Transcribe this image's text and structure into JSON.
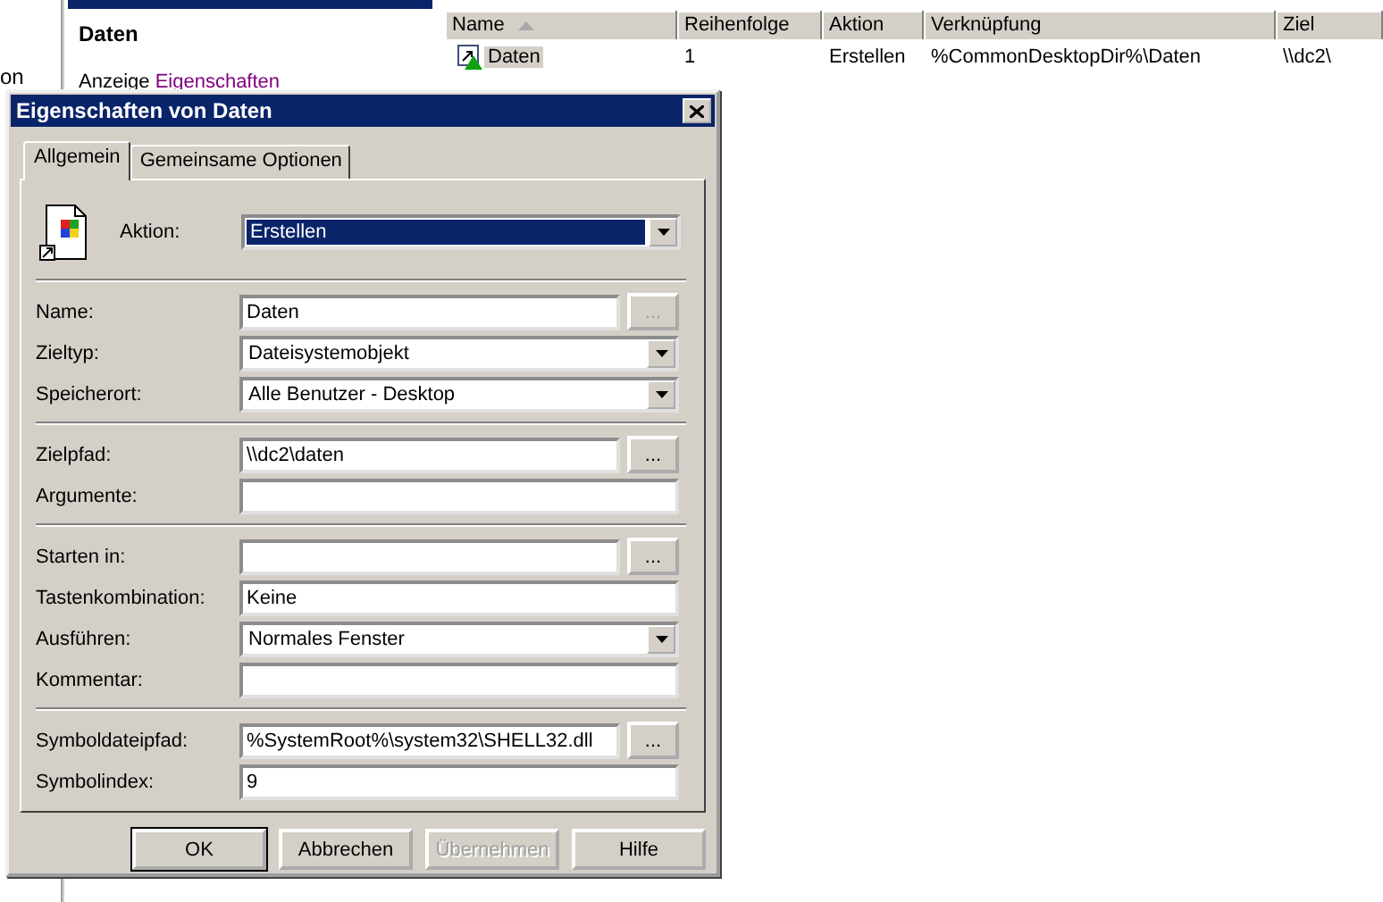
{
  "background": {
    "left_text": "on",
    "pane_title": "Daten",
    "view_label": "Anzeige",
    "view_link": "Eigenschaften",
    "list": {
      "columns": [
        {
          "label": "Name",
          "sorted": true
        },
        {
          "label": "Reihenfolge",
          "sorted": false
        },
        {
          "label": "Aktion",
          "sorted": false
        },
        {
          "label": "Verknüpfung",
          "sorted": false
        },
        {
          "label": "Ziel",
          "sorted": false
        }
      ],
      "rows": [
        {
          "selected": true,
          "cells": [
            "Daten",
            "1",
            "Erstellen",
            "%CommonDesktopDir%\\Daten",
            "\\\\dc2\\"
          ]
        }
      ]
    }
  },
  "dialog": {
    "title": "Eigenschaften von Daten",
    "tabs": [
      {
        "label": "Allgemein",
        "selected": true
      },
      {
        "label": "Gemeinsame Optionen",
        "selected": false
      }
    ],
    "action": {
      "label": "Aktion:",
      "value": "Erstellen",
      "focused": true
    },
    "groups": [
      [
        {
          "label": "Name:",
          "kind": "browse",
          "value": "Daten",
          "browse_label": "...",
          "browse_disabled": true
        },
        {
          "label": "Zieltyp:",
          "kind": "dropdown",
          "value": "Dateisystemobjekt"
        },
        {
          "label": "Speicherort:",
          "kind": "dropdown",
          "value": "Alle Benutzer - Desktop"
        }
      ],
      [
        {
          "label": "Zielpfad:",
          "kind": "browse",
          "value": "\\\\dc2\\daten",
          "browse_label": "...",
          "browse_disabled": false
        },
        {
          "label": "Argumente:",
          "kind": "text"
        }
      ],
      [
        {
          "label": "Starten in:",
          "kind": "browse",
          "browse_label": "...",
          "browse_disabled": false
        },
        {
          "label": "Tastenkombination:",
          "kind": "text",
          "value": "Keine"
        },
        {
          "label": "Ausführen:",
          "kind": "dropdown",
          "value": "Normales Fenster"
        },
        {
          "label": "Kommentar:",
          "kind": "text"
        }
      ],
      [
        {
          "label": "Symboldateipfad:",
          "kind": "browse",
          "value": "%SystemRoot%\\system32\\SHELL32.dll",
          "browse_label": "...",
          "browse_disabled": false
        },
        {
          "label": "Symbolindex:",
          "kind": "text",
          "value": "9"
        }
      ]
    ],
    "buttons": [
      {
        "label": "OK",
        "default": true,
        "disabled": false
      },
      {
        "label": "Abbrechen",
        "default": false,
        "disabled": false
      },
      {
        "label": "Übernehmen",
        "default": false,
        "disabled": true
      },
      {
        "label": "Hilfe",
        "default": false,
        "disabled": false
      }
    ]
  }
}
